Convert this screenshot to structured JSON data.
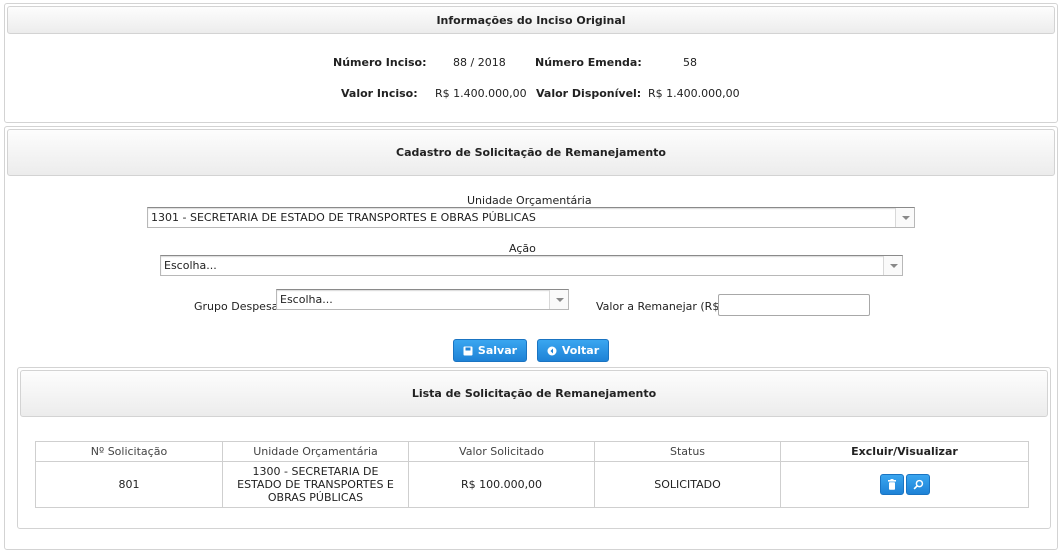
{
  "original_info": {
    "header": "Informações do Inciso Original",
    "numero_inciso_label": "Número Inciso:",
    "numero_inciso_value": "88 / 2018",
    "numero_emenda_label": "Número Emenda:",
    "numero_emenda_value": "58",
    "valor_inciso_label": "Valor Inciso:",
    "valor_inciso_value": "R$ 1.400.000,00",
    "valor_disponivel_label": "Valor Disponível:",
    "valor_disponivel_value": "R$ 1.400.000,00"
  },
  "form": {
    "header": "Cadastro de Solicitação de Remanejamento",
    "unidade_label": "Unidade Orçamentária",
    "unidade_value": "1301 - SECRETARIA DE ESTADO DE TRANSPORTES E OBRAS PÚBLICAS",
    "acao_label": "Ação",
    "acao_value": "Escolha...",
    "grupo_label": "Grupo Despesa",
    "grupo_value": "Escolha...",
    "valor_label": "Valor a Remanejar (R$)",
    "valor_value": "",
    "save_label": "Salvar",
    "back_label": "Voltar"
  },
  "list": {
    "header": "Lista de Solicitação de Remanejamento",
    "columns": [
      "Nº Solicitação",
      "Unidade Orçamentária",
      "Valor Solicitado",
      "Status",
      "Excluir/Visualizar"
    ],
    "rows": [
      {
        "numero": "801",
        "unidade": "1300 - SECRETARIA DE ESTADO DE TRANSPORTES E OBRAS PÚBLICAS",
        "valor": "R$ 100.000,00",
        "status": "SOLICITADO"
      }
    ]
  },
  "icons": {
    "save": "floppy-disk-icon",
    "back": "arrow-left-circle-icon",
    "delete": "trash-icon",
    "view": "magnifier-icon"
  },
  "colors": {
    "button": "#2290e2",
    "header_bg": "#ececec",
    "border": "#d3d3d3"
  }
}
